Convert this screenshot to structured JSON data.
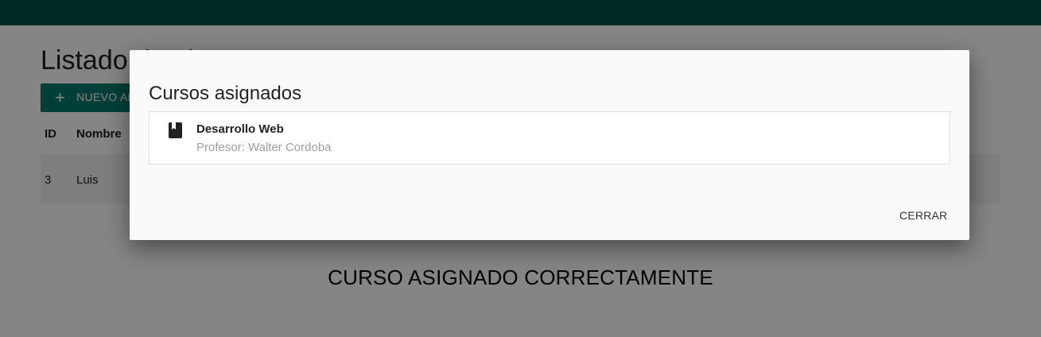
{
  "header": {
    "color": "#004f49"
  },
  "page": {
    "title": "Listado de alumnos",
    "new_button_icon": "plus-icon",
    "new_button_label": "NUEVO ALUMNO",
    "table": {
      "columns": [
        "ID",
        "Nombre"
      ],
      "rows": [
        {
          "id": "3",
          "name": "Luis"
        }
      ]
    }
  },
  "toast": {
    "message": "CURSO ASIGNADO CORRECTAMENTE"
  },
  "dialog": {
    "title": "Cursos asignados",
    "courses": [
      {
        "icon": "book-icon",
        "name": "Desarrollo Web",
        "teacher": "Profesor: Walter Cordoba"
      }
    ],
    "close_label": "CERRAR"
  },
  "colors": {
    "accent": "#00796b",
    "topbar": "#004f49"
  }
}
